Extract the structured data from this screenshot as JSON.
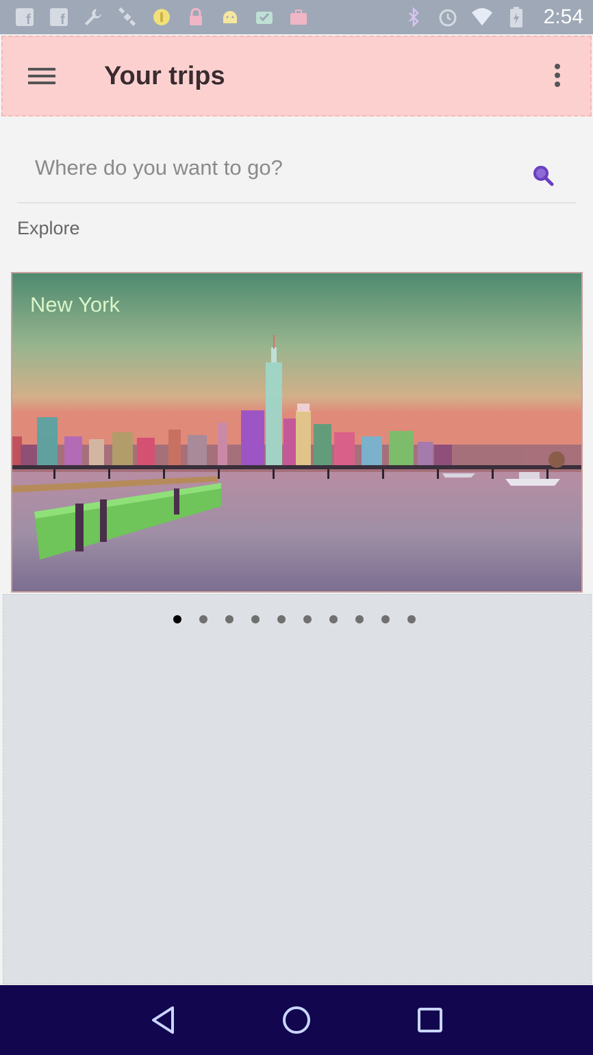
{
  "status_bar": {
    "time": "2:54",
    "left_icons": [
      "facebook-icon",
      "facebook-icon",
      "wrench-icon",
      "satellite-icon",
      "coin-icon",
      "lock-icon",
      "android-icon",
      "checkbox-icon",
      "briefcase-icon"
    ],
    "right_icons": [
      "bluetooth-icon",
      "alarm-icon",
      "wifi-icon",
      "battery-icon"
    ]
  },
  "app_bar": {
    "title": "Your trips",
    "background": "#fdd0d0"
  },
  "search": {
    "placeholder": "Where do you want to go?",
    "value": ""
  },
  "explore": {
    "label": "Explore"
  },
  "carousel": {
    "cards": [
      {
        "title": "New York"
      }
    ],
    "page_count": 10,
    "active_index": 0
  },
  "colors": {
    "accent": "#6a3fc1",
    "nav_bar": "#12064f",
    "status_bar": "#9ea8b6"
  }
}
